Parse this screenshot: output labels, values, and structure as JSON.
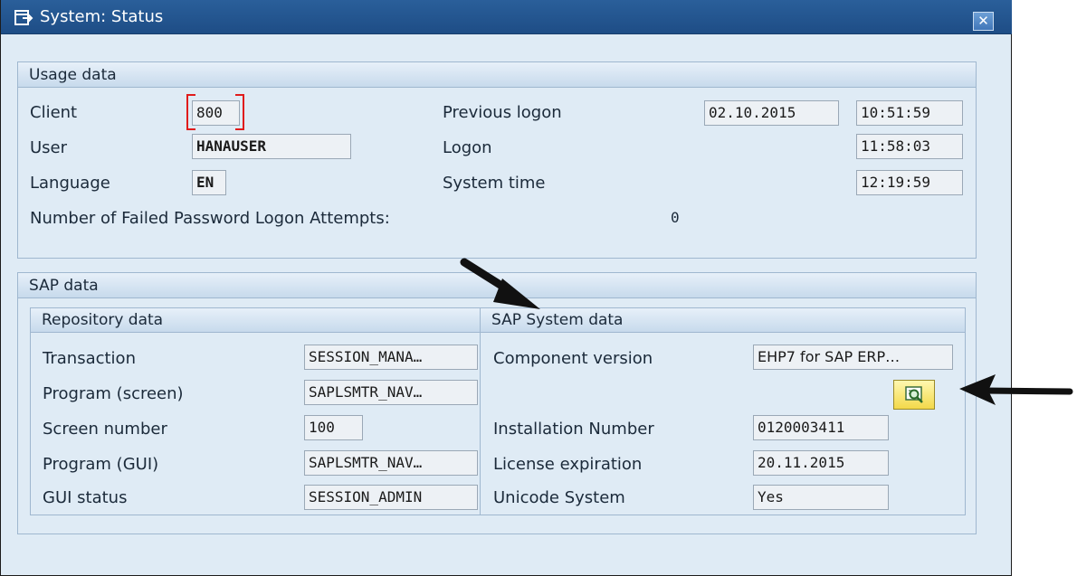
{
  "window": {
    "title": "System: Status",
    "close_icon": "close-icon"
  },
  "usage": {
    "header": "Usage data",
    "client_label": "Client",
    "client_value": "800",
    "user_label": "User",
    "user_value": "HANAUSER",
    "language_label": "Language",
    "language_value": "EN",
    "previous_logon_label": "Previous logon",
    "previous_logon_date": "02.10.2015",
    "previous_logon_time": "10:51:59",
    "logon_label": "Logon",
    "logon_time": "11:58:03",
    "system_time_label": "System time",
    "system_time_value": "12:19:59",
    "failed_label": "Number of Failed Password Logon Attempts:",
    "failed_value": "0"
  },
  "sap": {
    "header": "SAP data",
    "repository": {
      "header": "Repository data",
      "rows": [
        {
          "label": "Transaction",
          "value": "SESSION_MANA…"
        },
        {
          "label": "Program (screen)",
          "value": "SAPLSMTR_NAV…"
        },
        {
          "label": "Screen number",
          "value": "100"
        },
        {
          "label": "Program (GUI)",
          "value": "SAPLSMTR_NAV…"
        },
        {
          "label": "GUI status",
          "value": "SESSION_ADMIN"
        }
      ]
    },
    "system": {
      "header": "SAP System data",
      "component_label": "Component version",
      "component_value": "EHP7 for SAP ERP…",
      "details_icon": "magnifier-details-icon",
      "installation_label": "Installation Number",
      "installation_value": "0120003411",
      "license_label": "License expiration",
      "license_value": "20.11.2015",
      "unicode_label": "Unicode System",
      "unicode_value": "Yes"
    }
  },
  "colors": {
    "titlebar": "#1e4d86",
    "panel": "#dfebf5",
    "focus": "#e01b1b",
    "button": "#f3d94a"
  }
}
